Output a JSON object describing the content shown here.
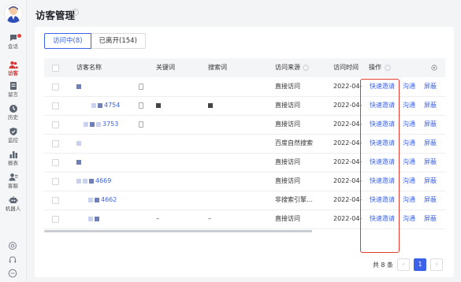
{
  "page": {
    "title": "访客管理"
  },
  "sidebar": {
    "items": [
      {
        "label": "会话",
        "icon": "chat-icon"
      },
      {
        "label": "访客",
        "icon": "visitors-icon",
        "active": true
      },
      {
        "label": "留言",
        "icon": "message-icon"
      },
      {
        "label": "历史",
        "icon": "history-icon"
      },
      {
        "label": "监控",
        "icon": "shield-icon"
      },
      {
        "label": "报表",
        "icon": "bar-chart-icon"
      },
      {
        "label": "客服",
        "icon": "agent-icon"
      },
      {
        "label": "机器人",
        "icon": "robot-icon"
      }
    ],
    "bottom_icons": [
      "settings-icon",
      "headset-icon",
      "more-icon"
    ]
  },
  "tabs": [
    {
      "label": "访问中(8)",
      "active": true
    },
    {
      "label": "已离开(154)",
      "active": false
    }
  ],
  "table": {
    "headers": [
      "访客名称",
      "关键词",
      "搜索词",
      "访问来源",
      "访问时间",
      "操作"
    ],
    "rows": [
      {
        "name": "",
        "source": "直接访问",
        "time": "2022-04-",
        "keyword": "",
        "search": ""
      },
      {
        "name": "4754",
        "source": "直接访问",
        "time": "2022-04-",
        "keyword": "",
        "search": ""
      },
      {
        "name": "3753",
        "source": "直接访问",
        "time": "2022-04-",
        "keyword": "",
        "search": ""
      },
      {
        "name": "",
        "source": "百度自然搜索",
        "time": "2022-04-",
        "keyword": "",
        "search": ""
      },
      {
        "name": "",
        "source": "直接访问",
        "time": "2022-04-",
        "keyword": "",
        "search": ""
      },
      {
        "name": "4669",
        "source": "直接访问",
        "time": "2022-04-",
        "keyword": "",
        "search": ""
      },
      {
        "name": "4662",
        "source": "非搜索引擎...",
        "time": "2022-04-",
        "keyword": "",
        "search": ""
      },
      {
        "name": "",
        "source": "直接访问",
        "time": "2022-04-",
        "keyword": "–",
        "search": "–"
      }
    ],
    "actions": {
      "invite": "快速邀请",
      "chat": "沟通",
      "block": "屏蔽"
    }
  },
  "pagination": {
    "total_text": "共 8 条",
    "current_page": "1",
    "prev": "‹",
    "next": "›"
  },
  "colors": {
    "accent": "#3b62e8",
    "highlight_box": "#e23b2e",
    "active_nav": "#d23b38"
  }
}
